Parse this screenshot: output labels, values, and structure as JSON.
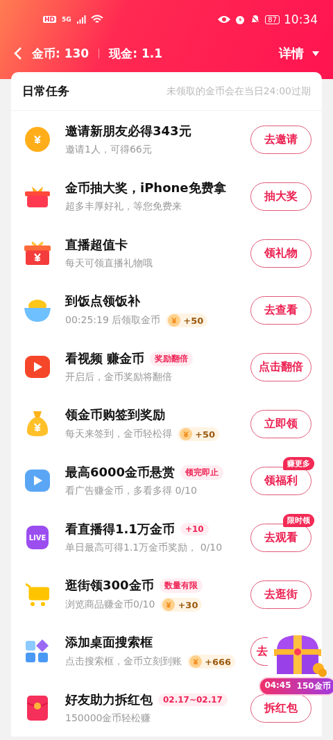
{
  "status_bar": {
    "hd": "HD",
    "network": "5G",
    "battery": "87",
    "time": "10:34"
  },
  "header": {
    "coins": "金币: 130",
    "cash": "现金: 1.1",
    "details": "详情"
  },
  "section": {
    "title": "日常任务",
    "note": "未领取的金币会在当日24:00过期"
  },
  "tasks": [
    {
      "kind": "coin",
      "title": "邀请新朋友必得343元",
      "subtitle": "邀请1人，可得66元",
      "button": "去邀请"
    },
    {
      "kind": "gift",
      "title": "金币抽大奖，iPhone免费拿",
      "subtitle": "超多丰厚好礼，等您免费来",
      "button": "抽大奖"
    },
    {
      "kind": "giftbox",
      "title": "直播超值卡",
      "subtitle": "每天可领直播礼物哦",
      "button": "领礼物"
    },
    {
      "kind": "bowl",
      "title": "到饭点领饭补",
      "subtitle": "00:25:19 后领取金币",
      "reward": "+50",
      "button": "去查看"
    },
    {
      "kind": "video",
      "color": "#f5462a",
      "title": "看视频 赚金币",
      "tag": "奖励翻倍",
      "subtitle": "开启后，金币奖励将翻倍",
      "button": "点击翻倍"
    },
    {
      "kind": "moneybag",
      "title": "领金币购签到奖励",
      "subtitle": "每天来签到，金币轻松得",
      "reward": "+50",
      "button": "立即领"
    },
    {
      "kind": "video",
      "color": "#5aa6f5",
      "title": "最高6000金币悬赏",
      "tag": "领完即止",
      "subtitle": "看广告赚金币，多看多得 0/10",
      "button": "领福利",
      "badge": "赚更多"
    },
    {
      "kind": "live",
      "icon_text": "LIVE",
      "title": "看直播得1.1万金币",
      "tag": "+10",
      "subtitle": "单日最高可得1.1万金币奖励， 0/10",
      "button": "去观看",
      "badge": "限时领"
    },
    {
      "kind": "cart",
      "title": "逛街领300金币",
      "tag": "数量有限",
      "subtitle": "浏览商品赚金币0/10",
      "reward": "+30",
      "button": "去逛街"
    },
    {
      "kind": "apps",
      "title": "添加桌面搜索框",
      "subtitle": "点击搜索框，金币立刻到账",
      "reward": "+666",
      "button": "去"
    },
    {
      "kind": "redpacket",
      "title": "好友助力拆红包",
      "tag": "02.17~02.17",
      "subtitle": "150000金币轻松赚",
      "button": "拆红包"
    }
  ],
  "floating_chest": {
    "timer": "04:45",
    "reward": "150金币"
  }
}
